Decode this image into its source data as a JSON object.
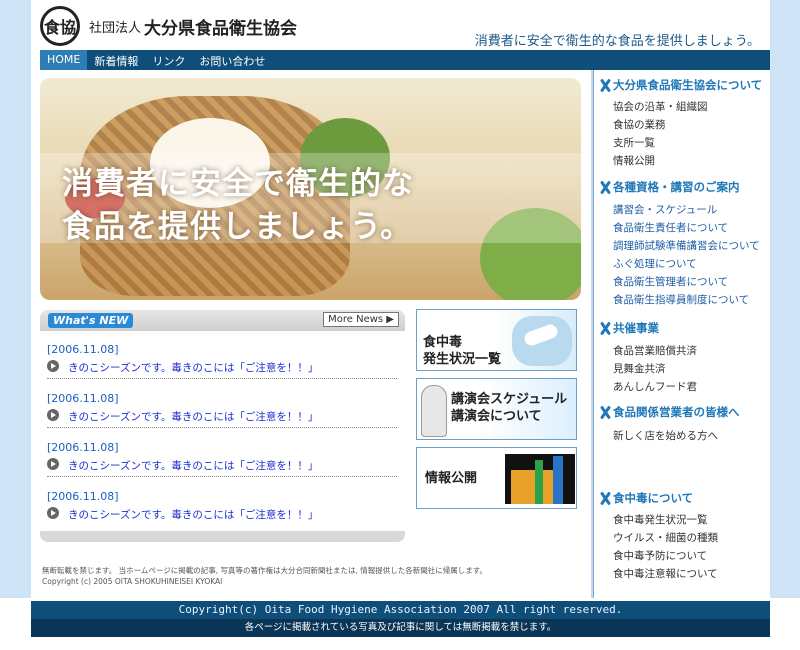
{
  "header": {
    "logo_text": "食協",
    "org_prefix": "社団法人",
    "org_name": "大分県食品衛生協会",
    "tagline": "消費者に安全で衛生的な食品を提供しましょう。"
  },
  "nav": [
    "HOME",
    "新着情報",
    "リンク",
    "お問い合わせ"
  ],
  "hero": {
    "line1": "消費者に安全で衛生的な",
    "line2": "食品を提供しましょう。"
  },
  "news": {
    "badge": "What's NEW",
    "more_label": "More News ▶",
    "items": [
      {
        "date": "[2006.11.08]",
        "title": "きのこシーズンです。毒きのこには「ご注意を！！」"
      },
      {
        "date": "[2006.11.08]",
        "title": "きのこシーズンです。毒きのこには「ご注意を！！」"
      },
      {
        "date": "[2006.11.08]",
        "title": "きのこシーズンです。毒きのこには「ご注意を！！」"
      },
      {
        "date": "[2006.11.08]",
        "title": "きのこシーズンです。毒きのこには「ご注意を！！」"
      }
    ]
  },
  "banners": {
    "food_poisoning": [
      "食中毒",
      "発生状況一覧"
    ],
    "lecture": [
      "講演会スケジュール",
      "講演会について"
    ],
    "info": "情報公開"
  },
  "copy_note": {
    "line1": "無断転載を禁じます。 当ホームページに掲載の記事, 写真等の著作権は大分合同新聞社または, 情報提供した各新聞社に帰属します。",
    "line2": "Copyright (c) 2005 OITA SHOKUHINEISEI KYOKAI"
  },
  "sidebar": {
    "sections": [
      {
        "title": "大分県食品衛生協会について",
        "items": [
          "協会の沿革・組織図",
          "食協の業務",
          "支所一覧",
          "情報公開"
        ],
        "blue": false
      },
      {
        "title": "各種資格・講習のご案内",
        "items": [
          "講習会・スケジュール",
          "食品衛生責任者について",
          "調理師試験準備講習会について",
          "ふぐ処理について",
          "食品衛生管理者について",
          "食品衛生指導員制度について"
        ],
        "blue": true
      },
      {
        "title": "共催事業",
        "items": [
          "食品営業賠償共済",
          "見舞金共済",
          "あんしんフード君"
        ],
        "blue": false
      },
      {
        "title": "食品関係営業者の皆様へ",
        "items": [
          "新しく店を始める方へ"
        ],
        "blue": false
      },
      {
        "title": "食中毒について",
        "items": [
          "食中毒発生状況一覧",
          "ウイルス・細菌の種類",
          "食中毒予防について",
          "食中毒注意報について"
        ],
        "blue": false
      }
    ]
  },
  "footer": {
    "copyright": "Copyright(c) Oita Food Hygiene Association 2007 All right reserved.",
    "notice": "各ページに掲載されている写真及び記事に関しては無断掲載を禁じます。"
  },
  "colors": {
    "nav_bg": "#0f4e78",
    "accent": "#1f78b8",
    "side_stripe": "#cfe3f6"
  }
}
